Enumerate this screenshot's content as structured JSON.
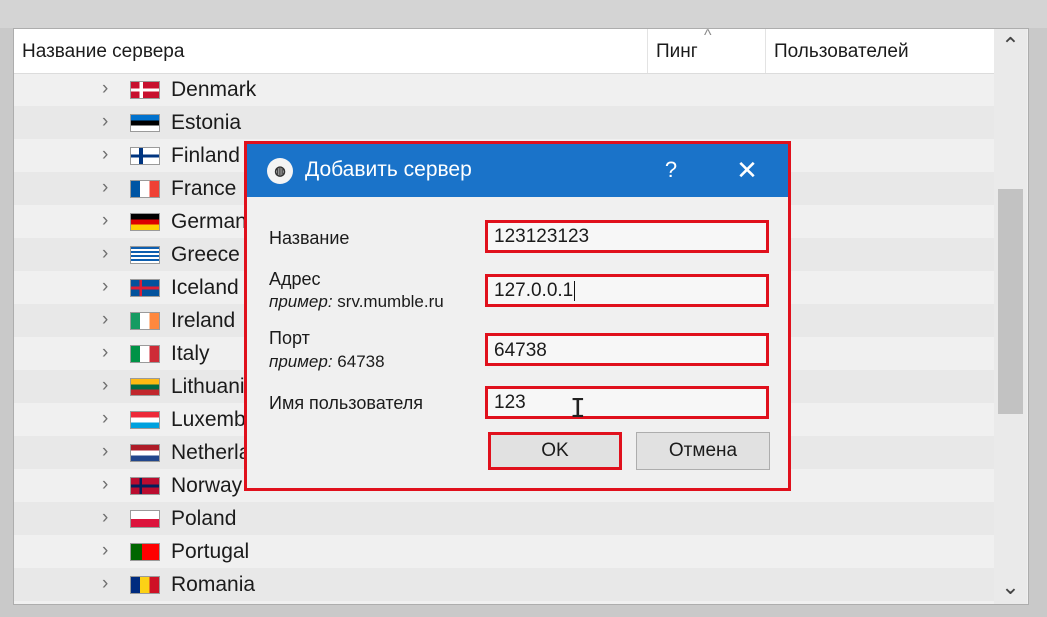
{
  "server_list": {
    "columns": {
      "name": "Название сервера",
      "ping": "Пинг",
      "users": "Пользователей"
    },
    "sort_indicator": "^",
    "countries": [
      {
        "name": "Denmark",
        "flag_icon": "flag-denmark-icon"
      },
      {
        "name": "Estonia",
        "flag_icon": "flag-estonia-icon"
      },
      {
        "name": "Finland",
        "flag_icon": "flag-finland-icon"
      },
      {
        "name": "France",
        "flag_icon": "flag-france-icon"
      },
      {
        "name": "Germany",
        "flag_icon": "flag-germany-icon"
      },
      {
        "name": "Greece",
        "flag_icon": "flag-greece-icon"
      },
      {
        "name": "Iceland",
        "flag_icon": "flag-iceland-icon"
      },
      {
        "name": "Ireland",
        "flag_icon": "flag-ireland-icon"
      },
      {
        "name": "Italy",
        "flag_icon": "flag-italy-icon"
      },
      {
        "name": "Lithuania",
        "flag_icon": "flag-lithuania-icon"
      },
      {
        "name": "Luxembourg",
        "flag_icon": "flag-luxembourg-icon"
      },
      {
        "name": "Netherlands",
        "flag_icon": "flag-netherlands-icon"
      },
      {
        "name": "Norway",
        "flag_icon": "flag-norway-icon"
      },
      {
        "name": "Poland",
        "flag_icon": "flag-poland-icon"
      },
      {
        "name": "Portugal",
        "flag_icon": "flag-portugal-icon"
      },
      {
        "name": "Romania",
        "flag_icon": "flag-romania-icon"
      }
    ]
  },
  "dialog": {
    "title": "Добавить сервер",
    "help_label": "?",
    "close_label": "✕",
    "fields": {
      "name": {
        "label": "Название",
        "value": "123123123"
      },
      "address": {
        "label": "Адрес",
        "example_prefix": "пример:",
        "example_value": "srv.mumble.ru",
        "value": "127.0.0.1"
      },
      "port": {
        "label": "Порт",
        "example_prefix": "пример:",
        "example_value": "64738",
        "value": "64738"
      },
      "username": {
        "label": "Имя пользователя",
        "value": "123"
      }
    },
    "ok_label": "OK",
    "cancel_label": "Отмена"
  },
  "colors": {
    "highlight": "#e0101c",
    "titlebar": "#1a73c9"
  }
}
